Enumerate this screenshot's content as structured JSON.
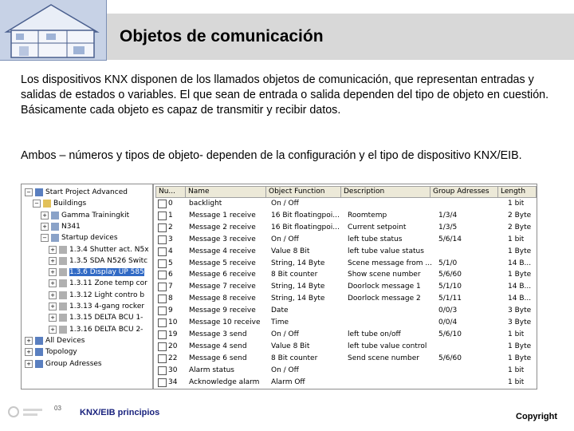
{
  "header": {
    "title": "Objetos de comunicación"
  },
  "body": {
    "paragraph1": "Los dispositivos KNX disponen de los llamados objetos de comunicación, que representan entradas y salidas de estados o variables. El que sean de entrada o salida dependen del tipo de objeto en cuestión.",
    "paragraph1b": "Básicamente cada objeto es capaz de transmitir y recibir datos.",
    "paragraph2": "Ambos – números y tipos de objeto- dependen de la configuración y el tipo de dispositivo KNX/EIB."
  },
  "tree": {
    "items": [
      {
        "label": "Start Project Advanced",
        "level": 0,
        "exp": "−"
      },
      {
        "label": "Buildings",
        "level": 1,
        "exp": "−"
      },
      {
        "label": "Gamma Trainingkit",
        "level": 2,
        "exp": "+"
      },
      {
        "label": "N341",
        "level": 2,
        "exp": "+"
      },
      {
        "label": "Startup devices",
        "level": 2,
        "exp": "−"
      },
      {
        "label": "1.3.4 Shutter act. N5x",
        "level": 3,
        "exp": "+"
      },
      {
        "label": "1.3.5 SDA N526 Switc",
        "level": 3,
        "exp": "+"
      },
      {
        "label": "1.3.6 Display UP 585",
        "level": 3,
        "exp": "+",
        "selected": true
      },
      {
        "label": "1.3.11 Zone temp cor",
        "level": 3,
        "exp": "+"
      },
      {
        "label": "1.3.12 Light contro b",
        "level": 3,
        "exp": "+"
      },
      {
        "label": "1.3.13 4-gang rocker",
        "level": 3,
        "exp": "+"
      },
      {
        "label": "1.3.15 DELTA BCU 1-",
        "level": 3,
        "exp": "+"
      },
      {
        "label": "1.3.16 DELTA BCU 2-",
        "level": 3,
        "exp": "+"
      },
      {
        "label": "All Devices",
        "level": 0,
        "exp": "+"
      },
      {
        "label": "Topology",
        "level": 0,
        "exp": "+"
      },
      {
        "label": "Group Adresses",
        "level": 0,
        "exp": "+"
      }
    ]
  },
  "table": {
    "headers": [
      "Nu...",
      "Name",
      "Object Function",
      "Description",
      "Group Adresses",
      "Length"
    ],
    "rows": [
      [
        "0",
        "backlight",
        "On / Off",
        "",
        "",
        "1 bit"
      ],
      [
        "1",
        "Message 1 receive",
        "16 Bit floatingpoi...",
        "Roomtemp",
        "1/3/4",
        "2 Byte"
      ],
      [
        "2",
        "Message 2 receive",
        "16 Bit floatingpoi...",
        "Current setpoint",
        "1/3/5",
        "2 Byte"
      ],
      [
        "3",
        "Message 3 receive",
        "On / Off",
        "left tube status",
        "5/6/14",
        "1 bit"
      ],
      [
        "4",
        "Message 4 receive",
        "Value 8 Bit",
        "left tube value status",
        "",
        "1 Byte"
      ],
      [
        "5",
        "Message 5 receive",
        "String, 14 Byte",
        "Scene message from ...",
        "5/1/0",
        "14 B..."
      ],
      [
        "6",
        "Message 6 receive",
        "8 Bit counter",
        "Show scene number",
        "5/6/60",
        "1 Byte"
      ],
      [
        "7",
        "Message 7 receive",
        "String, 14 Byte",
        "Doorlock message 1",
        "5/1/10",
        "14 B..."
      ],
      [
        "8",
        "Message 8 receive",
        "String, 14 Byte",
        "Doorlock message 2",
        "5/1/11",
        "14 B..."
      ],
      [
        "9",
        "Message 9 receive",
        "Date",
        "",
        "0/0/3",
        "3 Byte"
      ],
      [
        "10",
        "Message 10 receive",
        "Time",
        "",
        "0/0/4",
        "3 Byte"
      ],
      [
        "19",
        "Message 3 send",
        "On / Off",
        "left tube on/off",
        "5/6/10",
        "1 bit"
      ],
      [
        "20",
        "Message 4 send",
        "Value 8 Bit",
        "left tube value control",
        "",
        "1 Byte"
      ],
      [
        "22",
        "Message 6 send",
        "8 Bit counter",
        "Send scene number",
        "5/6/60",
        "1 Byte"
      ],
      [
        "30",
        "Alarm status",
        "On / Off",
        "",
        "",
        "1 bit"
      ],
      [
        "34",
        "Acknowledge alarm",
        "Alarm Off",
        "",
        "",
        "1 bit"
      ]
    ]
  },
  "footer": {
    "left": "KNX/EIB principios",
    "right": "Copyright",
    "page": "03"
  }
}
